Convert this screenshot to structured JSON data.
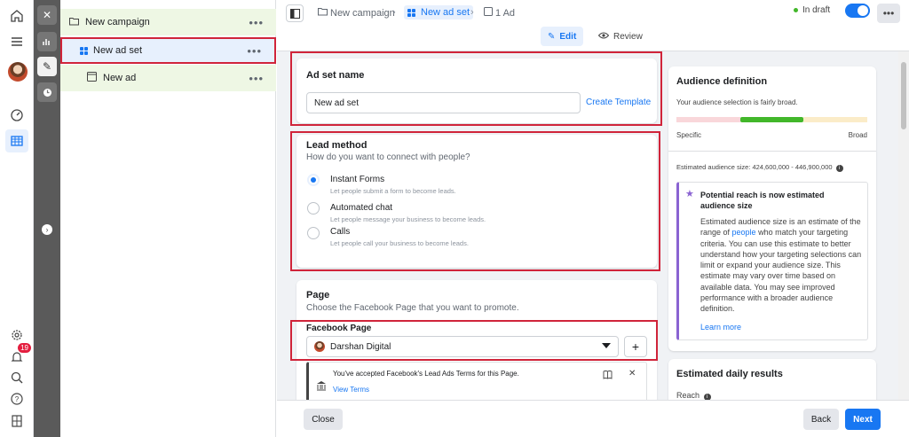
{
  "tree": {
    "campaign_label": "New campaign",
    "adset_label": "New ad set",
    "ad_label": "New ad",
    "more": "•••"
  },
  "rail": {
    "notification_count": "19"
  },
  "topbar": {
    "crumb_campaign": "New campaign",
    "crumb_adset": "New ad set",
    "crumb_ad": "1 Ad",
    "status": "In draft",
    "edit_tab": "Edit",
    "review_tab": "Review",
    "more": "•••"
  },
  "adset_name": {
    "heading": "Ad set name",
    "value": "New ad set",
    "template_link": "Create Template"
  },
  "lead_method": {
    "heading": "Lead method",
    "subheading": "How do you want to connect with people?",
    "selected_option": "Instant Forms",
    "options": [
      {
        "label": "Instant Forms",
        "desc": "Let people submit a form to become leads."
      },
      {
        "label": "Automated chat",
        "desc": "Let people message your business to become leads."
      },
      {
        "label": "Calls",
        "desc": "Let people call your business to become leads."
      }
    ]
  },
  "page_section": {
    "heading": "Page",
    "subheading": "Choose the Facebook Page that you want to promote.",
    "field_label": "Facebook Page",
    "selected_page": "Darshan Digital",
    "terms_text": "You've accepted Facebook's Lead Ads Terms for this Page.",
    "terms_link": "View Terms"
  },
  "audience": {
    "heading": "Audience definition",
    "summary": "Your audience selection is fairly broad.",
    "left_label": "Specific",
    "right_label": "Broad",
    "meter_level": "broad",
    "estimated_size": "Estimated audience size: 424,600,000 - 446,900,000",
    "notice_title": "Potential reach is now estimated audience size",
    "notice_body_1": "Estimated audience size is an estimate of the range of ",
    "notice_link": "people",
    "notice_body_2": " who match your targeting criteria. You can use this estimate to better understand how your targeting selections can limit or expand your audience size. This estimate may vary over time based on available data. You may see improved performance with a broader audience definition.",
    "learn_more": "Learn more"
  },
  "daily_results": {
    "heading": "Estimated daily results",
    "reach_label": "Reach"
  },
  "footer": {
    "close": "Close",
    "back": "Back",
    "next": "Next"
  },
  "colors": {
    "accent": "#1877f2",
    "highlight_border": "#d0243a",
    "green": "#42b72a"
  }
}
